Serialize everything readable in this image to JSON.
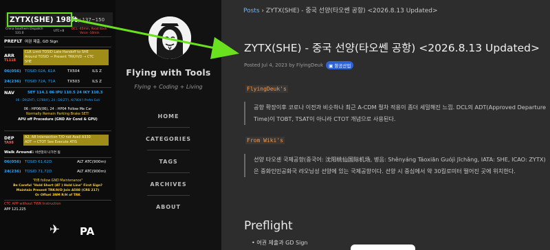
{
  "card": {
    "title": "ZYTX(SHE) 198ft",
    "title_extra": "Bay 137~150",
    "sub_left": "China Southern Dispatch",
    "sub_left2": "131.0",
    "sub_mid": "UTC+8",
    "sub_right": "DCL -40min, Read Back",
    "sub_right2": "Voice -10min",
    "preflt_tag": "PREFLT",
    "preflt_text": "여권 제출, GD Sign",
    "arr_tag": "ARR",
    "arr_sub": "TL118",
    "arr_text1": "CLR Limit TOSID Late Handoff to SHE",
    "arr_text2": "Around TOSID → Present TRK/H/D → CTC",
    "arr_text3": "SHE",
    "rwy06a": "06(056)",
    "rwy06a_proc": "TOSID 02A, 61A",
    "rwy06a_tx": "TX504",
    "rwy06a_ils": "ILS Z",
    "rwy24a": "24(236)",
    "rwy24a_proc": "TOSID 72A, 71A",
    "rwy24a_tx": "TX503",
    "rwy24a_ils": "ILS Z",
    "nav_tag": "NAV",
    "nav_text": "SEY 114.1 06 IPU 110.5 24 IKY 110.3",
    "nav_line2": "06 : D9(ZHT), C(7804'), 24 : D6(ZT'), K(7804') Prefer Exit",
    "nav_line3": "06 : HP06(06), 24 : HP04 Follow Me Car",
    "nav_line4": "Normally Remain Parking Brake SET!",
    "nav_line5": "APU off Procedure (GND Air Cond & GPU)",
    "dep_tag": "DEP",
    "dep_sub": "TA98",
    "dep_text1": "A2, A8 Intersection T/O not Avail A330",
    "dep_text2": "ADT → CTOT See Execute ATIS",
    "walk_tag": "Walk Around",
    "walk_text": "L1 비번앞의 나가면 됨",
    "rwy06d": "06(056)",
    "rwy06d_proc": "TOSID 61,62D",
    "rwy06d_alt": "ALT ATC(900m)",
    "rwy24d": "24(236)",
    "rwy24d_proc": "TOSID 71,72D",
    "rwy24d_alt": "ALT ATC(900m)",
    "warn1": "\"P/B follow GND Maintenance\"",
    "warn2": "Be Careful \"Hold Short (AT ) Hold Line\" First Sign?",
    "warn3": "Maintain Present TRK/H/D Join A588 (CRS 217)",
    "warn4": "Or Offset 3NM R/H of TRK",
    "ctc_text": "CTC APP without TWR Instruction",
    "app_text": "APP 121.225",
    "plane_glyph": "✈",
    "pa_text": "PA"
  },
  "sidebar": {
    "site_title": "Flying with Tools",
    "site_subtitle": "Flying + Coding + Living",
    "nav": [
      "HOME",
      "CATEGORIES",
      "TAGS",
      "ARCHIVES",
      "ABOUT"
    ]
  },
  "main": {
    "breadcrumb_link": "Posts",
    "breadcrumb_sep": "›",
    "breadcrumb_current": "ZYTX(SHE) - 중국 선양(타오쎈 공항) <2026.8.13 Updated>",
    "post_title": "ZYTX(SHE) - 중국 선양(타오쎈 공항) <2026.8.13 Updated>",
    "post_meta": "Posted Jul 4, 2023 by FlyingDeuk",
    "post_tag": "항공산업",
    "label1": "FlyingDeuk's",
    "quote1": "공항 확장이후 코로나 이전과 비슷하나 최근 A-CDM 절차 적용이 좀더 세밀해진 느낌. DCL의 ADT(Approved Departure Time)이 TOBT, TSAT이 아니라 CTOT 개념으로 사용된다.",
    "label2": "From Wiki's",
    "quote2": "선양 타오셴 국제공항(중국어: 沈阳桃仙国际机场, 병음: Shěnyáng Táoxiān Guójì Jīchǎng, IATA: SHE, ICAO: ZYTX)은 중화인민공화국 랴오닝성 선양에 있는 국제공항이다. 선양 시 중심에서 약 30킬로미터 떨어진 곳에 위치한다.",
    "section_title": "Preflight",
    "bullet": "여권 제출과 GD Sign"
  },
  "colors": {
    "accent_green": "#69e11e",
    "link_blue": "#6fb3ff",
    "tag_blue": "#2d63d6",
    "code_orange": "#f09a55"
  }
}
